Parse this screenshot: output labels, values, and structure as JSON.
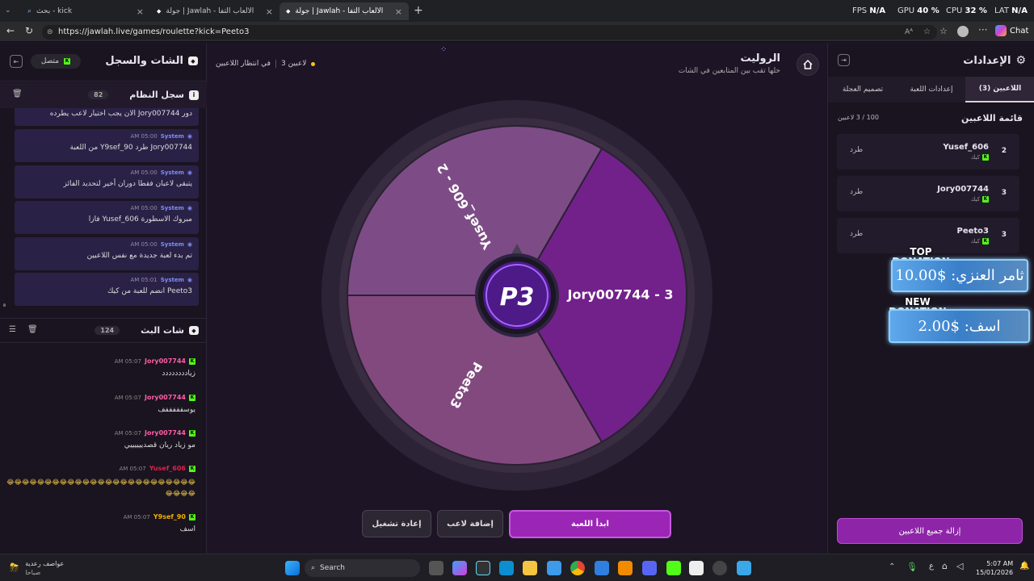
{
  "browser": {
    "tabs": [
      {
        "title": "بحث - kick"
      },
      {
        "title": "جولة | Jawlah - منصة الألعاب التفا"
      },
      {
        "title": "جولة | Jawlah - منصة الألعاب التفا"
      }
    ],
    "url": "https://jawlah.live/games/roulette?kick=Peeto3",
    "stats": [
      {
        "label": "FPS",
        "value": "N/A"
      },
      {
        "label": "GPU",
        "value": "40 %"
      },
      {
        "label": "CPU",
        "value": "32 %"
      },
      {
        "label": "LAT",
        "value": "N/A"
      }
    ],
    "chat_button": "Chat"
  },
  "left_panel": {
    "title": "الشات والسجل",
    "status": "متصل",
    "log": {
      "title": "سجل النظام",
      "count": "82",
      "partial_message": "دور Jory007744 الان يجب اختيار لاعب يطرده",
      "entries": [
        {
          "sender": "System",
          "time": "05:00 AM",
          "text": "Jory007744 طرد Y9sef_90 من اللعبة"
        },
        {
          "sender": "System",
          "time": "05:00 AM",
          "text": "يتبقى لاعبان فقطا دوران أخير لتحديد الفائز"
        },
        {
          "sender": "System",
          "time": "05:00 AM",
          "text": "مبروك الاسطورة Yusef_606 فازا"
        },
        {
          "sender": "System",
          "time": "05:00 AM",
          "text": "تم بدء لعبة جديدة مع نفس اللاعبين"
        },
        {
          "sender": "System",
          "time": "05:01 AM",
          "text": "Peeto3 انضم للعبة من كيك"
        }
      ]
    },
    "stream_chat": {
      "title": "شات البث",
      "count": "124",
      "messages": [
        {
          "user": "Jory007744",
          "time": "05:07 AM",
          "text": "زيادددددددد",
          "color": "#ff5ca8"
        },
        {
          "user": "Jory007744",
          "time": "05:07 AM",
          "text": "يوسفففففف",
          "color": "#ff5ca8"
        },
        {
          "user": "Jory007744",
          "time": "05:07 AM",
          "text": "مو زياد ريان قصدييييييي",
          "color": "#ff5ca8"
        },
        {
          "user": "Yusef_606",
          "time": "05:07 AM",
          "text": "😂😂😂😂😂😂😂😂😂😂😂😂😂😂😂😂😂😂😂😂😂😂😂😂😂😂😂😂😂",
          "color": "#e0204a"
        },
        {
          "user": "Y9sef_90",
          "time": "05:07 AM",
          "text": "اسف",
          "color": "#f2b000"
        }
      ]
    }
  },
  "center": {
    "title": "الروليت",
    "subtitle": "خلها تقب بين المتابعين في الشات",
    "status_waiting": "في انتظار اللاعبين",
    "status_players": "3 لاعبين",
    "wheel": {
      "logo_text": "P3",
      "segments": [
        {
          "label": "Jory007744 - 3",
          "color": "#72218a"
        },
        {
          "label": "Peeto3",
          "color": "#82497f"
        },
        {
          "label": "Yusef_606 - 2",
          "color": "#7d4c86"
        }
      ]
    },
    "buttons": {
      "start": "ابدأ اللعبة",
      "add_player": "إضافة لاعب",
      "restart": "إعادة تشغيل"
    }
  },
  "right_panel": {
    "title": "الإعدادات",
    "tabs": [
      "اللاعبين (3)",
      "إعدادات اللعبة",
      "تصميم العجلة"
    ],
    "players_header": "قائمة اللاعبين",
    "players_count": "100 / 3 لاعبين",
    "players": [
      {
        "name": "Yusef_606",
        "number": "2",
        "source": "كيك",
        "action": "طرد"
      },
      {
        "name": "Jory007744",
        "number": "3",
        "source": "كيك",
        "action": "طرد"
      },
      {
        "name": "Peeto3",
        "number": "3",
        "source": "كيك",
        "action": "طرد"
      }
    ],
    "remove_all": "إزالة جميع اللاعبين",
    "donations": {
      "top_label": "TOP DONATION",
      "top_text": "ثامر العنزي: $10.00",
      "new_label": "NEW DONATION",
      "new_text": "اسف: $2.00"
    }
  },
  "taskbar": {
    "weather_title": "عواصف رعدية",
    "weather_sub": "صباحا",
    "search": "Search",
    "lang": "ع",
    "time": "5:07 AM",
    "date": "15/01/2026"
  }
}
